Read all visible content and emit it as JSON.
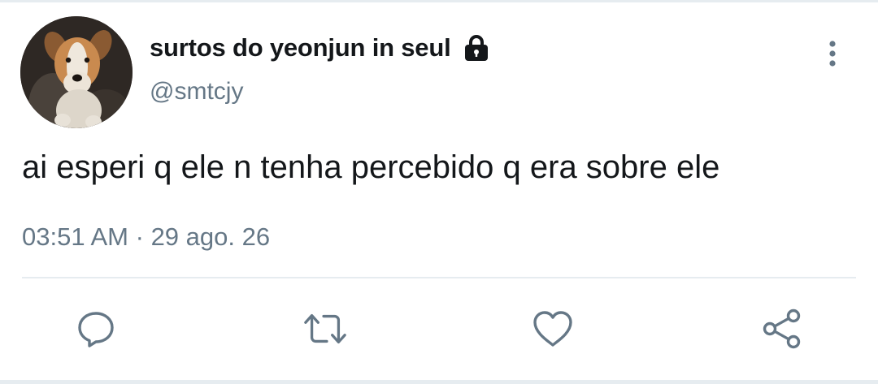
{
  "tweet": {
    "author": {
      "display_name": "surtos do yeonjun in seul",
      "handle": "@smtcjy",
      "avatar_icon": "dog-photo-avatar",
      "protected_icon": "lock-icon"
    },
    "text": "ai esperi q ele n tenha percebido q era sobre ele",
    "time": "03:51 AM",
    "separator": "·",
    "date": "29 ago. 26",
    "menu_icon": "more-vertical-icon"
  },
  "actions": [
    {
      "icon": "reply-icon"
    },
    {
      "icon": "retweet-icon"
    },
    {
      "icon": "like-icon"
    },
    {
      "icon": "share-icon"
    }
  ],
  "colors": {
    "text_primary": "#14171a",
    "text_secondary": "#657786",
    "icon": "#657786",
    "divider": "#e6ecf0"
  }
}
